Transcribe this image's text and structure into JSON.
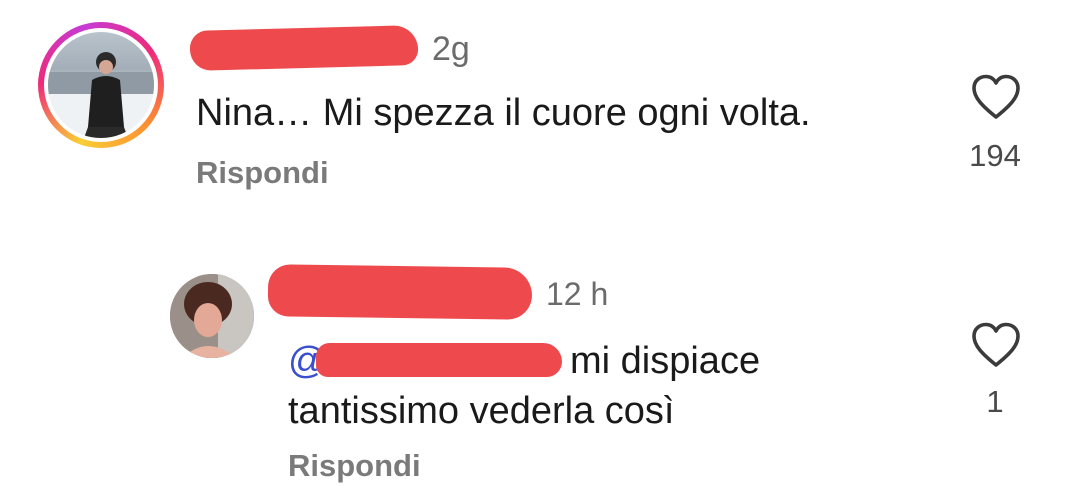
{
  "comments": [
    {
      "time": "2g",
      "text": "Nina… Mi spezza il cuore ogni volta.",
      "reply_label": "Rispondi",
      "likes": "194",
      "icon": "heart-outline-icon"
    },
    {
      "time": "12 h",
      "mention_prefix": "@",
      "text_line1": "mi dispiace",
      "text_line2": "tantissimo vederla così",
      "reply_label": "Rispondi",
      "likes": "1",
      "icon": "heart-outline-icon"
    }
  ],
  "colors": {
    "redaction": "#ee4a4e",
    "mention": "#3a4fd0",
    "muted_text": "#7a7a7a"
  }
}
